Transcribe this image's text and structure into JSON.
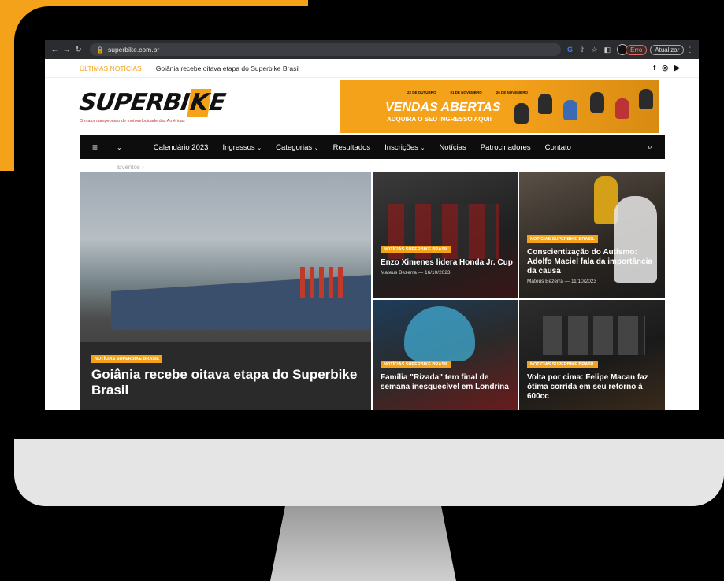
{
  "browser": {
    "url": "superbike.com.br",
    "error_label": "Erro",
    "update_label": "Atualizar"
  },
  "ticker": {
    "label": "ÚLTIMAS NOTÍCIAS",
    "headline": "Goiânia recebe oitava etapa do Superbike Brasil"
  },
  "header": {
    "logo_main": "SUPERBI",
    "logo_accent": "K",
    "logo_end": "E",
    "tagline": "O maior campeonato de motovelocidade das Américas",
    "banner": {
      "dates": [
        "22 DE OUTUBRO",
        "01 DE NOVEMBRO",
        "26 DE NOVEMBRO"
      ],
      "title": "VENDAS ABERTAS",
      "subtitle": "ADQUIRA O SEU INGRESSO AQUI!"
    }
  },
  "nav": {
    "items": [
      {
        "label": "Calendário 2023",
        "dropdown": false
      },
      {
        "label": "Ingressos",
        "dropdown": true
      },
      {
        "label": "Categorias",
        "dropdown": true
      },
      {
        "label": "Resultados",
        "dropdown": false
      },
      {
        "label": "Inscrições",
        "dropdown": true
      },
      {
        "label": "Notícias",
        "dropdown": false
      },
      {
        "label": "Patrocinadores",
        "dropdown": false
      },
      {
        "label": "Contato",
        "dropdown": false
      }
    ],
    "sub_label": "Eventos"
  },
  "articles": [
    {
      "category": "Notícias Superbike Brasil",
      "title": "Goiânia recebe oitava etapa do Superbike Brasil",
      "meta": ""
    },
    {
      "category": "Notícias Superbike Brasil",
      "title": "Enzo Ximenes lidera Honda Jr. Cup",
      "meta": "Mateus Bezerra — 16/10/2023"
    },
    {
      "category": "Notícias Superbike Brasil",
      "title": "Conscientização do Autismo: Adolfo Maciel fala da importância da causa",
      "meta": "Mateus Bezerra — 11/10/2023"
    },
    {
      "category": "Notícias Superbike Brasil",
      "title": "Família \"Rizada\" tem final de semana inesquecível em Londrina",
      "meta": ""
    },
    {
      "category": "Notícias Superbike Brasil",
      "title": "Volta por cima: Felipe Macan faz ótima corrida em seu retorno à 600cc",
      "meta": ""
    }
  ],
  "colors": {
    "accent": "#f5a21b",
    "nav_bg": "#0d0d0d",
    "error": "#e36a5e"
  }
}
